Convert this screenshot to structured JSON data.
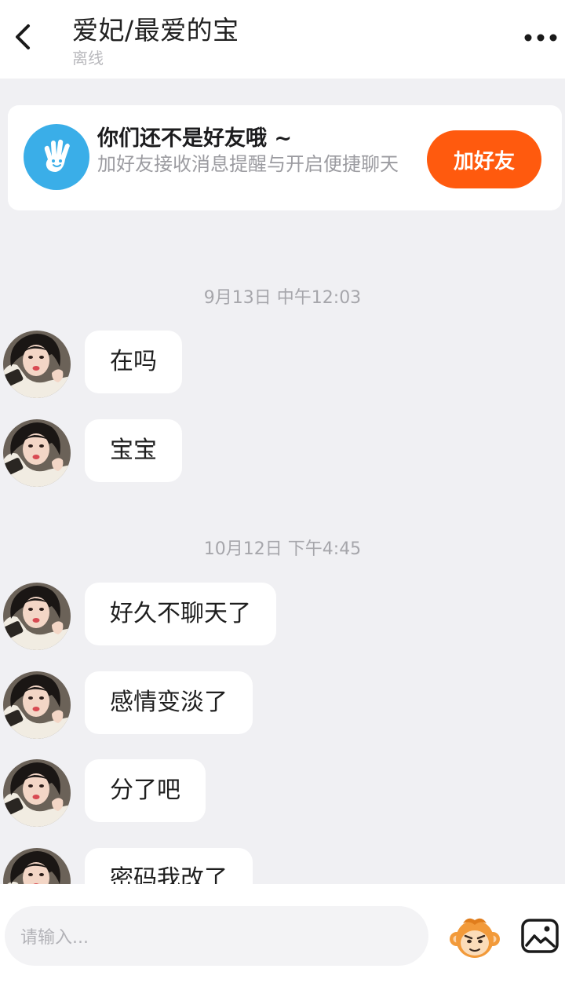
{
  "header": {
    "title": "爱妃/最爱的宝",
    "status": "离线"
  },
  "friend_card": {
    "title": "你们还不是好友哦 ~",
    "description": "加好友接收消息提醒与开启便捷聊天",
    "button_label": "加好友",
    "button_color": "#ff5a0e",
    "icon_color": "#3aaee8"
  },
  "chat": {
    "timestamps": [
      "9月13日 中午12:03",
      "10月12日 下午4:45"
    ],
    "messages": [
      {
        "text": "在吗"
      },
      {
        "text": "宝宝"
      },
      {
        "text": "好久不聊天了"
      },
      {
        "text": "感情变淡了"
      },
      {
        "text": "分了吧"
      },
      {
        "text": "密码我改了"
      }
    ]
  },
  "input": {
    "placeholder": "请输入..."
  },
  "icons": {
    "back": "chevron-left-icon",
    "more": "more-dots-icon",
    "emoji": "monkey-emoji-icon",
    "image": "image-icon"
  }
}
